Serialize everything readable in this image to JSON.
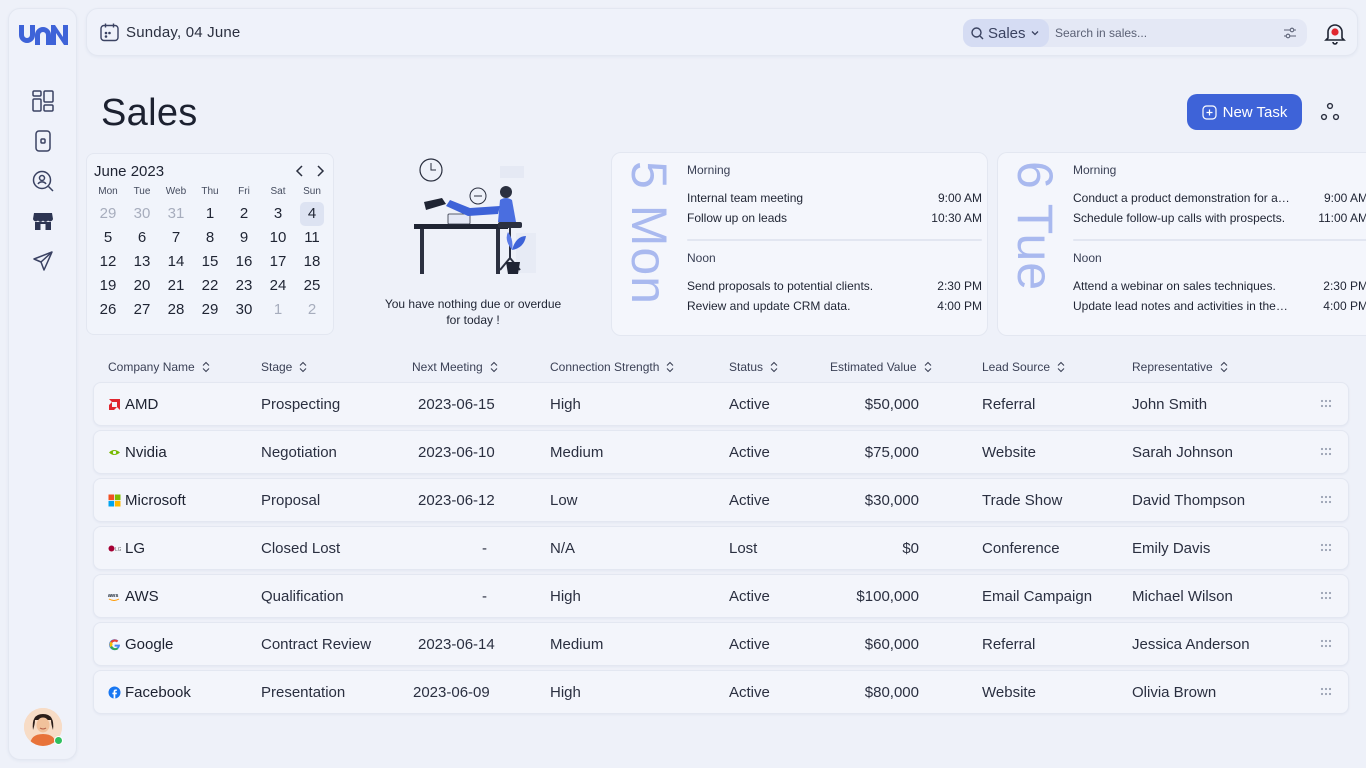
{
  "topbar": {
    "date": "Sunday, 04 June",
    "search_scope": "Sales",
    "search_placeholder": "Search in sales..."
  },
  "page": {
    "title": "Sales",
    "new_task_label": "New Task"
  },
  "calendar": {
    "month_label": "June 2023",
    "weekdays": [
      "Mon",
      "Tue",
      "Web",
      "Thu",
      "Fri",
      "Sat",
      "Sun"
    ],
    "weeks": [
      [
        "29",
        "30",
        "31",
        "1",
        "2",
        "3",
        "4"
      ],
      [
        "5",
        "6",
        "7",
        "8",
        "9",
        "10",
        "11"
      ],
      [
        "12",
        "13",
        "14",
        "15",
        "16",
        "17",
        "18"
      ],
      [
        "19",
        "20",
        "21",
        "22",
        "23",
        "24",
        "25"
      ],
      [
        "26",
        "27",
        "28",
        "29",
        "30",
        "1",
        "2"
      ]
    ]
  },
  "empty_state": {
    "message_line1": "You have nothing due or overdue",
    "message_line2": "for today !"
  },
  "days": [
    {
      "label": "5 Mon",
      "morning_title": "Morning",
      "morning": [
        {
          "name": "Internal team meeting",
          "time": "9:00 AM"
        },
        {
          "name": "Follow up on leads",
          "time": "10:30 AM"
        }
      ],
      "noon_title": "Noon",
      "noon": [
        {
          "name": "Send proposals to potential clients.",
          "time": "2:30 PM"
        },
        {
          "name": "Review and update CRM data.",
          "time": "4:00 PM"
        }
      ]
    },
    {
      "label": "6 Tue",
      "morning_title": "Morning",
      "morning": [
        {
          "name": "Conduct a product demonstration for a potential client.",
          "time": "9:00 AM"
        },
        {
          "name": "Schedule follow-up calls with prospects.",
          "time": "11:00 AM"
        }
      ],
      "noon_title": "Noon",
      "noon": [
        {
          "name": "Attend a webinar on sales techniques.",
          "time": "2:30 PM"
        },
        {
          "name": "Update lead notes and activities in the CRM.",
          "time": "4:00 PM"
        }
      ]
    }
  ],
  "table": {
    "columns": [
      "Company Name",
      "Stage",
      "Next Meeting",
      "Connection Strength",
      "Status",
      "Estimated Value",
      "Lead Source",
      "Representative"
    ],
    "rows": [
      {
        "company": "AMD",
        "logo": "amd-logo",
        "stage": "Prospecting",
        "next_meeting": "2023-06-15",
        "strength": "High",
        "status": "Active",
        "value": "$50,000",
        "source": "Referral",
        "rep": "John Smith"
      },
      {
        "company": "Nvidia",
        "logo": "nvidia-logo",
        "stage": "Negotiation",
        "next_meeting": "2023-06-10",
        "strength": "Medium",
        "status": "Active",
        "value": "$75,000",
        "source": "Website",
        "rep": "Sarah Johnson"
      },
      {
        "company": "Microsoft",
        "logo": "microsoft-logo",
        "stage": "Proposal",
        "next_meeting": "2023-06-12",
        "strength": "Low",
        "status": "Active",
        "value": "$30,000",
        "source": "Trade Show",
        "rep": "David Thompson"
      },
      {
        "company": "LG",
        "logo": "lg-logo",
        "stage": "Closed Lost",
        "next_meeting": "-",
        "strength": "N/A",
        "status": "Lost",
        "value": "$0",
        "source": "Conference",
        "rep": "Emily Davis"
      },
      {
        "company": "AWS",
        "logo": "aws-logo",
        "stage": "Qualification",
        "next_meeting": "-",
        "strength": "High",
        "status": "Active",
        "value": "$100,000",
        "source": "Email Campaign",
        "rep": "Michael Wilson"
      },
      {
        "company": "Google",
        "logo": "google-logo",
        "stage": "Contract Review",
        "next_meeting": "2023-06-14",
        "strength": "Medium",
        "status": "Active",
        "value": "$60,000",
        "source": "Referral",
        "rep": "Jessica Anderson"
      },
      {
        "company": "Facebook",
        "logo": "facebook-logo",
        "stage": "Presentation",
        "next_meeting": "2023-06-09",
        "strength": "High",
        "status": "Active",
        "value": "$80,000",
        "source": "Website",
        "rep": "Olivia Brown"
      }
    ]
  },
  "colors": {
    "accent": "#3e63d8",
    "background": "#eef1f9",
    "day_label": "#a9b9ef",
    "online": "#2fbf5f"
  }
}
